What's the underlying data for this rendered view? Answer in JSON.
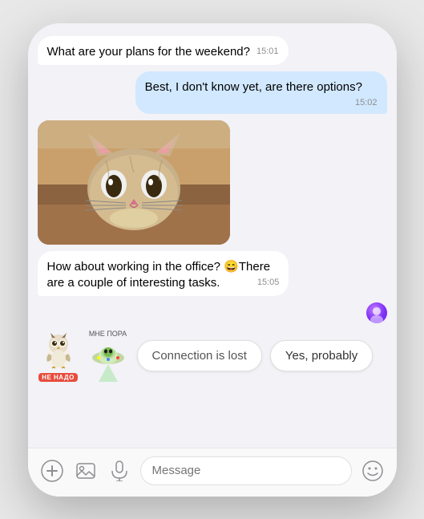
{
  "chat": {
    "messages": [
      {
        "id": "msg1",
        "side": "left",
        "text": "What are your plans for the weekend?",
        "time": "15:01"
      },
      {
        "id": "msg2",
        "side": "right",
        "text": "Best, I don't know yet, are there options?",
        "time": "15:02"
      },
      {
        "id": "msg3",
        "side": "left",
        "type": "image",
        "alt": "Cat photo"
      },
      {
        "id": "msg4",
        "side": "left",
        "text": "How about working in the office? 😄There are a couple of interesting tasks.",
        "time": "15:05"
      }
    ],
    "stickers": {
      "owl_emoji": "🦉",
      "alien_emoji": "👽",
      "tag_text": "НЕ НАДО",
      "alien_label": "МНЕ   ПОРА"
    },
    "quick_replies": [
      {
        "id": "qr1",
        "label": "Connection is lost"
      },
      {
        "id": "qr2",
        "label": "Yes, probably"
      }
    ],
    "input": {
      "placeholder": "Message"
    },
    "icons": {
      "plus": "+",
      "image": "🖼",
      "mic": "🎤",
      "emoji": "🙂"
    }
  }
}
